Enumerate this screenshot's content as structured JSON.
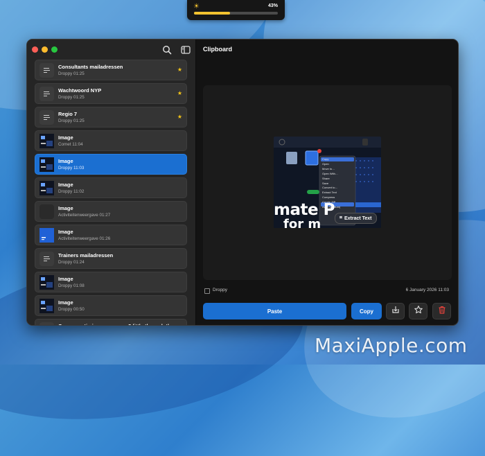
{
  "brightness": {
    "percent_label": "43%",
    "level": 0.43,
    "icon": "sun-icon"
  },
  "window": {
    "title": "Clipboard",
    "traffic_lights": [
      "close",
      "minimize",
      "zoom"
    ]
  },
  "sidebar": {
    "icons": [
      "search-icon",
      "sidebar-toggle-icon"
    ],
    "items": [
      {
        "title": "Consultants mailadressen",
        "meta": "Droppy  01:25",
        "kind": "text",
        "starred": true
      },
      {
        "title": "Wachtwoord NYP",
        "meta": "Droppy  01:25",
        "kind": "text",
        "starred": true
      },
      {
        "title": "Regio 7",
        "meta": "Droppy  01:25",
        "kind": "text",
        "starred": true
      },
      {
        "title": "Image",
        "meta": "Comet  11:04",
        "kind": "dark",
        "starred": false
      },
      {
        "title": "Image",
        "meta": "Droppy  11:03",
        "kind": "dark",
        "starred": false,
        "selected": true
      },
      {
        "title": "Image",
        "meta": "Droppy  11:02",
        "kind": "dark",
        "starred": false
      },
      {
        "title": "Image",
        "meta": "Activiteitenweergave  01:27",
        "kind": "plain",
        "starred": false
      },
      {
        "title": "Image",
        "meta": "Activiteitenweergave  01:26",
        "kind": "blue",
        "starred": false
      },
      {
        "title": "Trainers mailadressen",
        "meta": "Droppy  01:24",
        "kind": "text",
        "starred": false
      },
      {
        "title": "Image",
        "meta": "Droppy  01:08",
        "kind": "dark",
        "starred": false
      },
      {
        "title": "Image",
        "meta": "Droppy  00:50",
        "kind": "dark",
        "starred": false
      },
      {
        "title": "Can we optimize your usage? little through the",
        "meta": "",
        "kind": "text",
        "starred": false
      }
    ]
  },
  "preview": {
    "menu_items": [
      "Copy",
      "Open",
      "Move to…",
      "Open With…",
      "Share",
      "Save",
      "Convert to…",
      "Extract Text",
      "Compress",
      "Create ZIP",
      "Auto (Medium)"
    ],
    "big_text_1": "mate P",
    "big_text_2": "for m",
    "extract_label": "Extract Text",
    "source": "Droppy",
    "date": "6 January 2026  11:03"
  },
  "actions": {
    "paste": "Paste",
    "copy": "Copy"
  },
  "icons": {
    "save": "save-to-file-icon",
    "favorite": "star-icon",
    "delete": "trash-icon"
  },
  "colors": {
    "accent": "#1b6fd1",
    "star": "#f5c518",
    "delete": "#e5433c"
  },
  "watermark": "MaxiApple.com"
}
